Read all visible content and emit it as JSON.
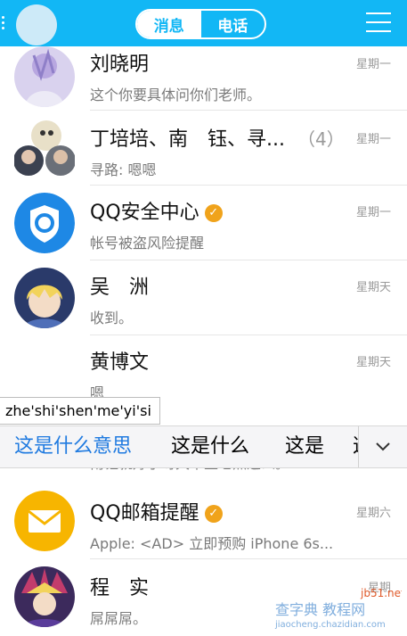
{
  "header": {
    "tabs": [
      {
        "label": "消息"
      },
      {
        "label": "电话"
      }
    ],
    "brand_color": "#12b7f5"
  },
  "conversations": [
    {
      "name": "刘晓明",
      "time": "星期一",
      "preview": "这个你要具体问你们老师。"
    },
    {
      "name": "丁培培、南　钰、寻...",
      "count": "（4）",
      "time": "星期一",
      "preview": "寻路: 嗯嗯"
    },
    {
      "name": "QQ安全中心",
      "verified": true,
      "time": "星期一",
      "preview": "帐号被盗风险提醒"
    },
    {
      "name": "吴　洲",
      "time": "星期天",
      "preview": "收到。"
    },
    {
      "name": "黄博文",
      "time": "星期天",
      "preview": "嗯"
    },
    {
      "name": "QQ邮箱提醒",
      "verified": true,
      "time": "星期六",
      "preview": "Apple: <AD> 立即预购 iPhone 6s..."
    },
    {
      "name": "程　实",
      "time": "星期",
      "preview": "屌屌屌。"
    }
  ],
  "ime": {
    "pinyin": "zhe'shi'shen'me'yi'si",
    "candidates": [
      "这是什么意思",
      "这是什么",
      "这是",
      "这"
    ],
    "selected_index": 0,
    "hidden_preview": "南钰就好了呀大本生七点这么。"
  },
  "watermark": {
    "line1": "jb51.net",
    "line2": "查字典 教程网",
    "line3": "jiaocheng.chazidian.com"
  }
}
